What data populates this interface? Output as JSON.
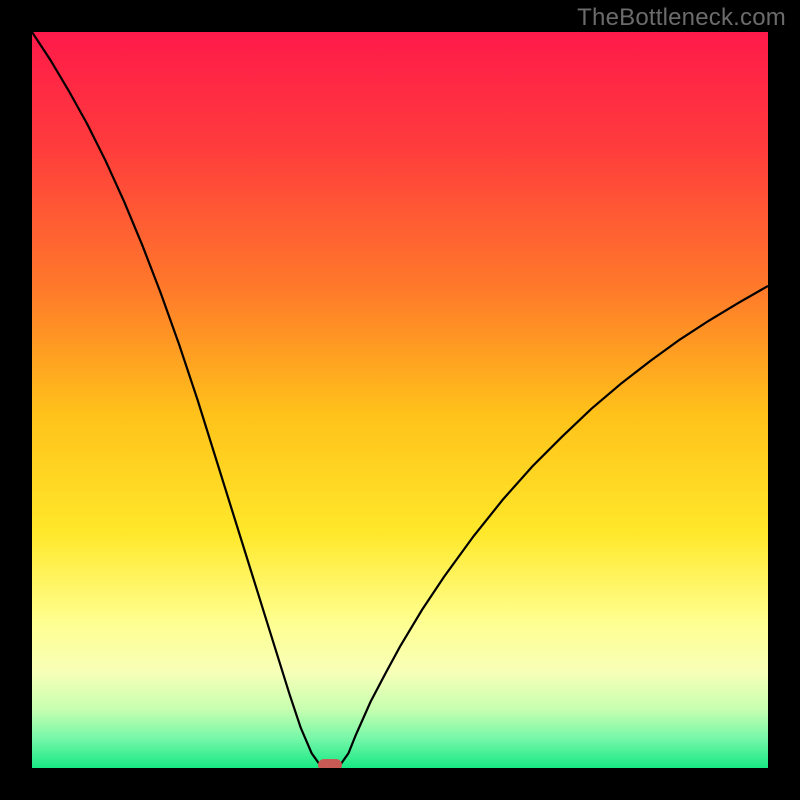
{
  "watermark": "TheBottleneck.com",
  "chart_data": {
    "type": "line",
    "title": "",
    "xlabel": "",
    "ylabel": "",
    "xlim": [
      0,
      100
    ],
    "ylim": [
      0,
      100
    ],
    "background_gradient": {
      "stops": [
        {
          "pos": 0.0,
          "color": "#ff1a4a"
        },
        {
          "pos": 0.15,
          "color": "#ff3a3d"
        },
        {
          "pos": 0.35,
          "color": "#ff7a2a"
        },
        {
          "pos": 0.52,
          "color": "#ffc21a"
        },
        {
          "pos": 0.68,
          "color": "#ffe82a"
        },
        {
          "pos": 0.8,
          "color": "#ffff8f"
        },
        {
          "pos": 0.87,
          "color": "#f7ffb8"
        },
        {
          "pos": 0.92,
          "color": "#c7ffb0"
        },
        {
          "pos": 0.96,
          "color": "#76f7a8"
        },
        {
          "pos": 1.0,
          "color": "#17e884"
        }
      ]
    },
    "series": [
      {
        "name": "bottleneck-curve",
        "color": "#000000",
        "width": 2.2,
        "x": [
          0.0,
          2.5,
          5.0,
          7.5,
          10.0,
          12.5,
          15.0,
          17.5,
          20.0,
          22.5,
          25.0,
          27.5,
          30.0,
          32.5,
          35.0,
          36.5,
          38.0,
          39.0,
          40.0,
          41.0,
          42.0,
          43.0,
          44.0,
          46.0,
          48.0,
          50.0,
          53.0,
          56.0,
          60.0,
          64.0,
          68.0,
          72.0,
          76.0,
          80.0,
          84.0,
          88.0,
          92.0,
          96.0,
          100.0
        ],
        "values": [
          100.0,
          96.2,
          92.0,
          87.5,
          82.5,
          77.0,
          71.0,
          64.5,
          57.5,
          50.0,
          42.0,
          34.0,
          26.0,
          18.0,
          10.0,
          5.5,
          2.0,
          0.6,
          0.1,
          0.1,
          0.6,
          2.0,
          4.5,
          9.0,
          12.8,
          16.5,
          21.5,
          26.0,
          31.5,
          36.5,
          41.0,
          45.0,
          48.8,
          52.2,
          55.3,
          58.2,
          60.8,
          63.2,
          65.5
        ]
      }
    ],
    "marker": {
      "name": "optimal-point",
      "x": 40.5,
      "y": 0.0,
      "color": "#c85a56"
    }
  }
}
